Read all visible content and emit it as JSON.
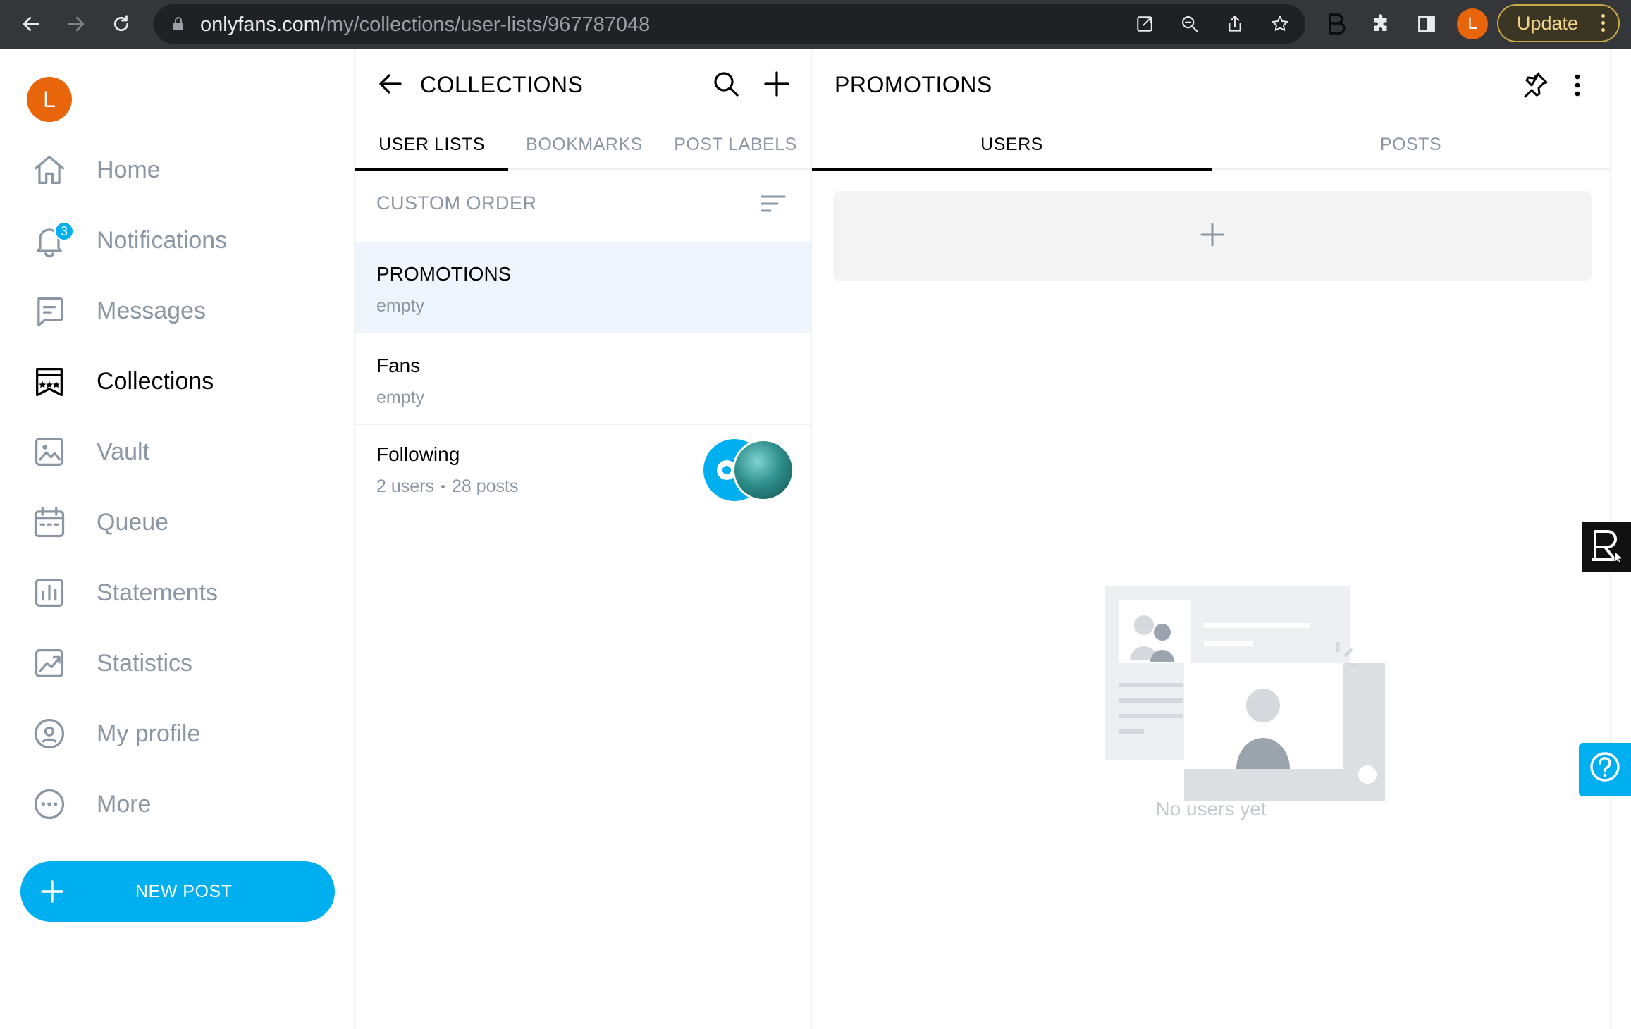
{
  "browser": {
    "url_domain": "onlyfans.com",
    "url_path": "/my/collections/user-lists/967787048",
    "profile_initial": "L",
    "update_label": "Update"
  },
  "sidebar": {
    "avatar_initial": "L",
    "items": [
      {
        "label": "Home",
        "icon": "home-icon"
      },
      {
        "label": "Notifications",
        "icon": "bell-icon",
        "badge": "3"
      },
      {
        "label": "Messages",
        "icon": "message-icon"
      },
      {
        "label": "Collections",
        "icon": "collections-icon",
        "active": true
      },
      {
        "label": "Vault",
        "icon": "image-icon"
      },
      {
        "label": "Queue",
        "icon": "calendar-icon"
      },
      {
        "label": "Statements",
        "icon": "bar-chart-icon"
      },
      {
        "label": "Statistics",
        "icon": "line-chart-icon"
      },
      {
        "label": "My profile",
        "icon": "profile-icon"
      },
      {
        "label": "More",
        "icon": "more-icon"
      }
    ],
    "new_post_label": "NEW POST"
  },
  "collections": {
    "title": "COLLECTIONS",
    "tabs": [
      {
        "label": "USER LISTS",
        "active": true
      },
      {
        "label": "BOOKMARKS"
      },
      {
        "label": "POST LABELS"
      }
    ],
    "sort_label": "CUSTOM ORDER",
    "lists": [
      {
        "name": "PROMOTIONS",
        "sub": "empty",
        "selected": true
      },
      {
        "name": "Fans",
        "sub": "empty"
      },
      {
        "name": "Following",
        "sub_users": "2 users",
        "sub_posts": "28 posts"
      }
    ]
  },
  "detail": {
    "title": "PROMOTIONS",
    "tabs": [
      {
        "label": "USERS",
        "active": true
      },
      {
        "label": "POSTS"
      }
    ],
    "empty_text": "No users yet"
  },
  "colors": {
    "accent": "#00aff0",
    "muted_text": "#8a96a3",
    "avatar_orange": "#e8650b",
    "selected_row": "#eef5fc"
  }
}
